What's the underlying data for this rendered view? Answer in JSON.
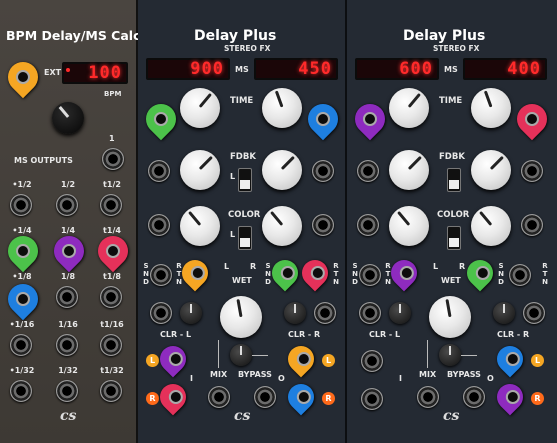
{
  "bpm_module": {
    "title": "BPM Delay/MS Calc",
    "ext_label": "EXT",
    "bpm_value": "100",
    "bpm_label": "BPM",
    "outputs_label": "MS OUTPUTS",
    "one_label": "1",
    "rows": [
      [
        "•1/2",
        "1/2",
        "t1/2"
      ],
      [
        "•1/4",
        "1/4",
        "t1/4"
      ],
      [
        "•1/8",
        "1/8",
        "t1/8"
      ],
      [
        "•1/16",
        "1/16",
        "t1/16"
      ],
      [
        "•1/32",
        "1/32",
        "t1/32"
      ]
    ]
  },
  "delay1": {
    "title": "Delay Plus",
    "subtitle": "STEREO FX",
    "left_ms": "900",
    "right_ms": "450",
    "ms_label": "MS",
    "time_label": "TIME",
    "fdbk_label": "FDBK",
    "color_label": "COLOR",
    "l_label": "L",
    "r_label": "R",
    "wet_label": "WET",
    "snd_label": "S N D",
    "rtn_label": "R T N",
    "clr_l": "CLR - L",
    "clr_r": "CLR - R",
    "mix_label": "MIX",
    "bypass_label": "BYPASS",
    "i_label": "I",
    "o_label": "O"
  },
  "delay2": {
    "title": "Delay Plus",
    "subtitle": "STEREO FX",
    "left_ms": "600",
    "right_ms": "400",
    "ms_label": "MS",
    "time_label": "TIME",
    "fdbk_label": "FDBK",
    "color_label": "COLOR",
    "l_label": "L",
    "r_label": "R",
    "wet_label": "WET",
    "snd_label": "S N D",
    "rtn_label": "R T N",
    "clr_l": "CLR - L",
    "clr_r": "CLR - R",
    "mix_label": "MIX",
    "bypass_label": "BYPASS",
    "i_label": "I",
    "o_label": "O"
  },
  "colors": {
    "orange": "#f5a623",
    "green": "#4cc24a",
    "purple": "#8e2bbf",
    "red": "#e5315a",
    "blue": "#1e7fe0",
    "led_red": "#ff2a2a"
  }
}
